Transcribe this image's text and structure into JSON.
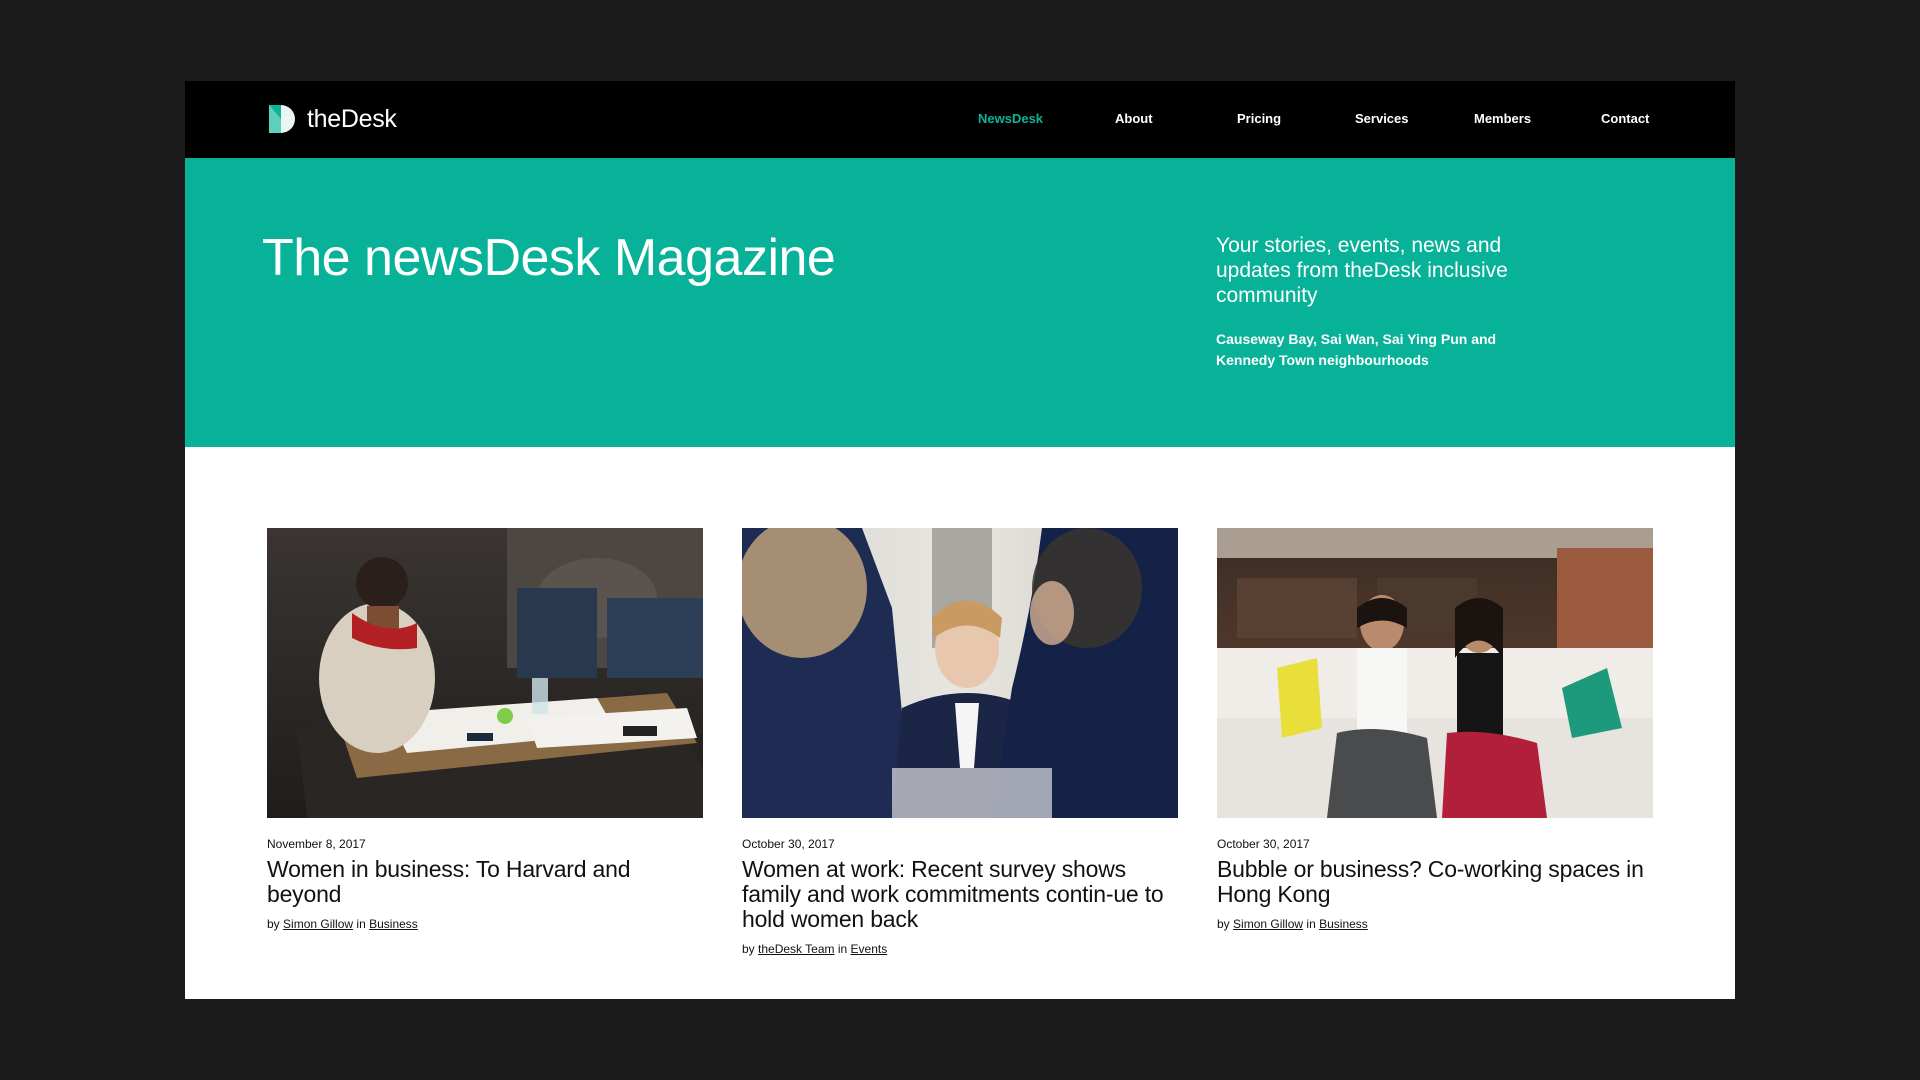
{
  "brand": {
    "name": "theDesk",
    "accent": "#10b39a",
    "hero_bg": "#08b298"
  },
  "nav": {
    "items": [
      {
        "label": "NewsDesk",
        "active": true
      },
      {
        "label": "About",
        "active": false
      },
      {
        "label": "Pricing",
        "active": false
      },
      {
        "label": "Services",
        "active": false
      },
      {
        "label": "Members",
        "active": false
      },
      {
        "label": "Contact",
        "active": false
      }
    ]
  },
  "hero": {
    "title": "The newsDesk Magazine",
    "tagline": "Your stories, events, news and updates from theDesk inclusive community",
    "subtext": "Causeway Bay, Sai Wan, Sai Ying Pun and Kennedy Town neighbourhoods"
  },
  "articles": [
    {
      "date": "November 8, 2017",
      "title": "Women in business: To Harvard and beyond",
      "by": "by",
      "author": "Simon Gillow",
      "in": "in",
      "category": "Business",
      "image": "group-of-women-working-at-table-photo"
    },
    {
      "date": "October 30, 2017",
      "title": "Women at work: Recent survey shows family and work commitments contin-ue to hold women back",
      "by": "by",
      "author": "theDesk Team",
      "in": "in",
      "category": "Events",
      "image": "women-in-meeting-photo"
    },
    {
      "date": "October 30, 2017",
      "title": "Bubble or business? Co-working spaces in Hong Kong",
      "by": "by",
      "author": "Simon Gillow",
      "in": "in",
      "category": "Business",
      "image": "two-women-on-sofa-photo"
    }
  ]
}
